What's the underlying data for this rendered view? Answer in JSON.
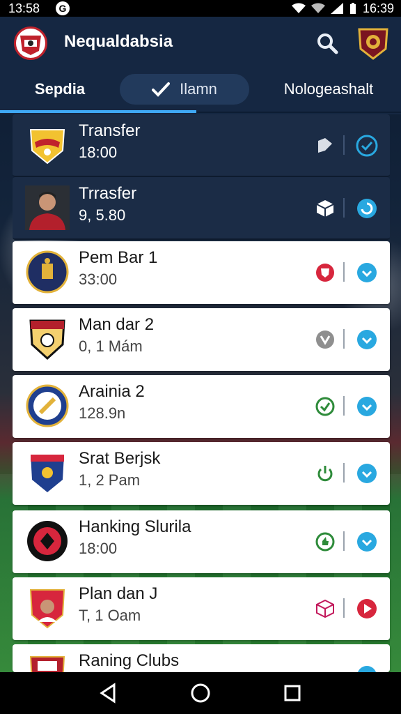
{
  "status_bar": {
    "time_left": "13:58",
    "time_right": "16:39",
    "icons": [
      "google-icon",
      "wifi-icon",
      "signal-icon",
      "battery-icon"
    ]
  },
  "header": {
    "app_title": "Nequaldabsia",
    "icons": [
      "club-logo-icon",
      "search-icon",
      "profile-badge-icon"
    ]
  },
  "tabs": [
    {
      "label": "Sepdia",
      "active": true
    },
    {
      "label": "Ilamn",
      "icon": "pencil-icon"
    },
    {
      "label": "Nologeashalt"
    }
  ],
  "items": [
    {
      "name": "Transfer",
      "time": "18:00",
      "style": "dark",
      "action1": "share-icon",
      "action2": "check-circle-icon"
    },
    {
      "name": "Trrasfer",
      "time": "9, 5.80",
      "style": "dark",
      "action1": "cube-icon",
      "action2": "refresh-circle-icon"
    },
    {
      "name": "Pem Bar 1",
      "time": "33:00",
      "style": "light",
      "action1": "shield-icon",
      "action2": "chevron-circle-icon"
    },
    {
      "name": "Man dar 2",
      "time": "0, 1 Mám",
      "style": "light",
      "action1": "v-circle-icon",
      "action2": "chevron-circle-icon"
    },
    {
      "name": "Arainia 2",
      "time": "128.9n",
      "style": "light",
      "action1": "check-circle-icon",
      "action2": "chevron-circle-icon"
    },
    {
      "name": "Srat Berjsk",
      "time": "1, 2 Pam",
      "style": "light",
      "action1": "power-icon",
      "action2": "chevron-circle-icon"
    },
    {
      "name": "Hanking Slurila",
      "time": "18:00",
      "style": "light",
      "action1": "thumb-icon",
      "action2": "chevron-circle-icon"
    },
    {
      "name": "Plan dan J",
      "time": "T, 1 Oam",
      "style": "light",
      "action1": "cube-icon",
      "action2": "play-circle-icon"
    },
    {
      "name": "Raning Clubs",
      "time": "",
      "style": "light",
      "action1": "",
      "action2": "chevron-circle-icon"
    }
  ],
  "colors": {
    "header_bg": "#152742",
    "dark_card": "#1b2c46",
    "accent_blue": "#29a8e0",
    "tab_indicator": "#3fa9f5",
    "red": "#d7263d",
    "green": "#2e8b3a"
  },
  "nav": [
    "back-icon",
    "home-icon",
    "recents-icon"
  ]
}
